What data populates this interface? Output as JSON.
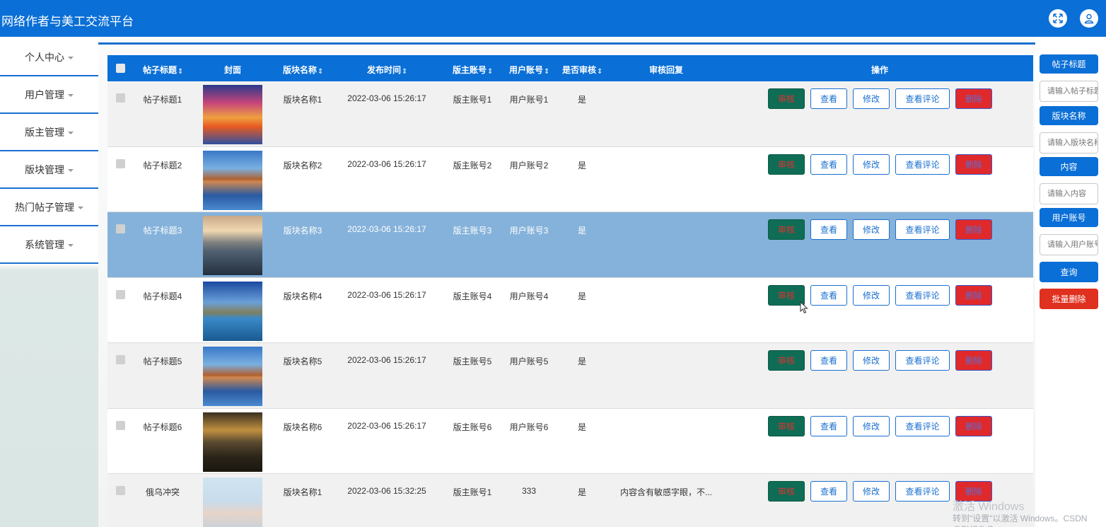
{
  "app": {
    "title": "网络作者与美工交流平台"
  },
  "sidebar": {
    "items": [
      {
        "label": "个人中心"
      },
      {
        "label": "用户管理"
      },
      {
        "label": "版主管理"
      },
      {
        "label": "版块管理"
      },
      {
        "label": "热门帖子管理"
      },
      {
        "label": "系统管理"
      }
    ]
  },
  "table": {
    "headers": {
      "title": "帖子标题",
      "cover": "封面",
      "board": "版块名称",
      "time": "发布时间",
      "moderator": "版主账号",
      "user": "用户账号",
      "audited": "是否审核",
      "reply": "审核回复",
      "ops": "操作"
    },
    "rows": [
      {
        "title": "帖子标题1",
        "board": "版块名称1",
        "time": "2022-03-06 15:26:17",
        "moderator": "版主账号1",
        "user": "用户账号1",
        "audited": "是",
        "reply": ""
      },
      {
        "title": "帖子标题2",
        "board": "版块名称2",
        "time": "2022-03-06 15:26:17",
        "moderator": "版主账号2",
        "user": "用户账号2",
        "audited": "是",
        "reply": ""
      },
      {
        "title": "帖子标题3",
        "board": "版块名称3",
        "time": "2022-03-06 15:26:17",
        "moderator": "版主账号3",
        "user": "用户账号3",
        "audited": "是",
        "reply": ""
      },
      {
        "title": "帖子标题4",
        "board": "版块名称4",
        "time": "2022-03-06 15:26:17",
        "moderator": "版主账号4",
        "user": "用户账号4",
        "audited": "是",
        "reply": ""
      },
      {
        "title": "帖子标题5",
        "board": "版块名称5",
        "time": "2022-03-06 15:26:17",
        "moderator": "版主账号5",
        "user": "用户账号5",
        "audited": "是",
        "reply": ""
      },
      {
        "title": "帖子标题6",
        "board": "版块名称6",
        "time": "2022-03-06 15:26:17",
        "moderator": "版主账号6",
        "user": "用户账号6",
        "audited": "是",
        "reply": ""
      },
      {
        "title": "俄乌冲突",
        "board": "版块名称1",
        "time": "2022-03-06 15:32:25",
        "moderator": "版主账号1",
        "user": "333",
        "audited": "是",
        "reply": "内容含有敏感字眼，不..."
      }
    ],
    "actions": {
      "audit": "审核",
      "view": "查看",
      "edit": "修改",
      "comments": "查看评论",
      "delete": "删除"
    }
  },
  "search": {
    "title_label": "帖子标题",
    "title_placeholder": "请输入帖子标题",
    "board_label": "版块名称",
    "board_placeholder": "请输入版块名称",
    "content_label": "内容",
    "content_placeholder": "请输入内容",
    "user_label": "用户账号",
    "user_placeholder": "请输入用户账号",
    "query_button": "查询",
    "batch_delete_button": "批量删除"
  },
  "watermark": {
    "line1": "激活 Windows",
    "line2": "转到\"设置\"以激活 Windows。CSDN @BYSJLG"
  },
  "colors": {
    "primary": "#0a6fd6",
    "audit_button": "#0f6d56",
    "delete_button": "#e0292a",
    "highlight_row": "#85b2da"
  }
}
